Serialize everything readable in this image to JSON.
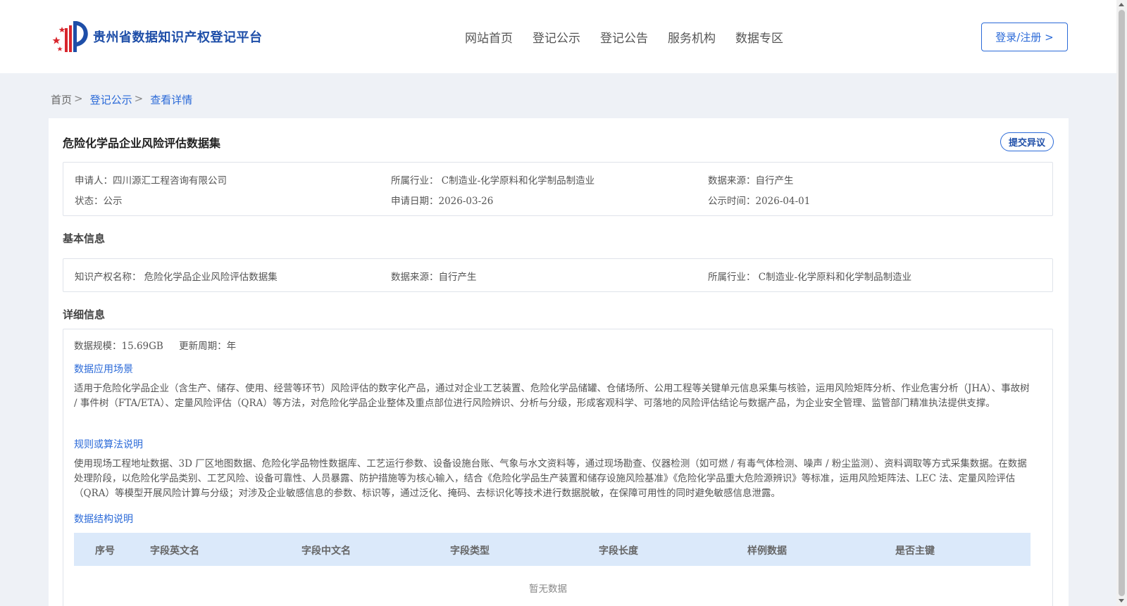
{
  "header": {
    "logo_text": "贵州省数据知识产权登记平台",
    "nav": [
      "网站首页",
      "登记公示",
      "登记公告",
      "服务机构",
      "数据专区"
    ],
    "login_label": "登录/注册 >"
  },
  "breadcrumb": {
    "home": "首页",
    "sep": ">",
    "items": [
      "登记公示",
      "查看详情"
    ]
  },
  "detail": {
    "title": "危险化学品企业风险评估数据集",
    "objection_label": "提交异议",
    "summary": {
      "applicant": "申请人：四川源汇工程咨询有限公司",
      "industry": "所属行业： C制造业-化学原料和化学制品制造业",
      "source": "数据来源：自行产生",
      "status": "状态：公示",
      "apply_date": "申请日期：2026-03-26",
      "publish_date": "公示时间：2026-04-01"
    },
    "basic_title": "基本信息",
    "basic": {
      "ip_name": "知识产权名称： 危险化学品企业风险评估数据集",
      "source": "数据来源：自行产生",
      "industry": "所属行业： C制造业-化学原料和化学制品制造业"
    },
    "detail_title": "详细信息",
    "scale": "数据规模：15.69GB",
    "cycle": "更新周期：年",
    "scene_title": "数据应用场景",
    "scene_text": "适用于危险化学品企业（含生产、储存、使用、经营等环节）风险评估的数字化产品，通过对企业工艺装置、危险化学品储罐、仓储场所、公用工程等关键单元信息采集与核验，运用风险矩阵分析、作业危害分析（JHA）、事故树 / 事件树（FTA/ETA）、定量风险评估（QRA）等方法，对危险化学品企业整体及重点部位进行风险辨识、分析与分级，形成客观科学、可落地的风险评估结论与数据产品，为企业安全管理、监管部门精准执法提供支撑。",
    "algo_title": "规则或算法说明",
    "algo_text": "使用现场工程地址数据、3D 厂区地图数据、危险化学品物性数据库、工艺运行参数、设备设施台账、气象与水文资料等，通过现场勘查、仪器检测（如可燃 / 有毒气体检测、噪声 / 粉尘监测）、资料调取等方式采集数据。在数据处理阶段，以危险化学品类别、工艺风险、设备可靠性、人员暴露、防护措施等为核心输入，结合《危险化学品生产装置和储存设施风险基准》《危险化学品重大危险源辨识》等标准，运用风险矩阵法、LEC 法、定量风险评估（QRA）等模型开展风险计算与分级；对涉及企业敏感信息的参数、标识等，通过泛化、掩码、去标识化等技术进行数据脱敏，在保障可用性的同时避免敏感信息泄露。",
    "structure_title": "数据结构说明",
    "table_headers": [
      "序号",
      "字段英文名",
      "字段中文名",
      "字段类型",
      "字段长度",
      "样例数据",
      "是否主键"
    ],
    "empty_text": "暂无数据"
  }
}
